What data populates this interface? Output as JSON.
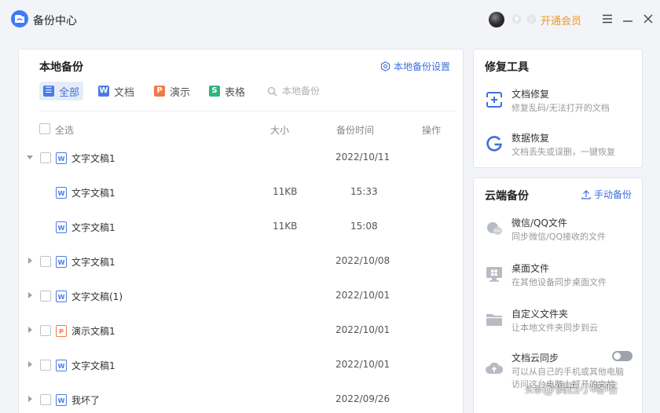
{
  "app": {
    "title": "备份中心"
  },
  "account": {
    "vip_link": "开通会员"
  },
  "local_backup": {
    "title": "本地备份",
    "settings_link": "本地备份设置",
    "filters": [
      {
        "label": "全部",
        "icon": "list-icon",
        "color": "#4a7be6"
      },
      {
        "label": "文档",
        "icon": "word-doc-icon",
        "color": "#4a7be6"
      },
      {
        "label": "演示",
        "icon": "presentation-icon",
        "color": "#f07a4a"
      },
      {
        "label": "表格",
        "icon": "spreadsheet-icon",
        "color": "#2eb57d"
      }
    ],
    "search_placeholder": "本地备份",
    "columns": {
      "select_all": "全选",
      "size": "大小",
      "time": "备份时间",
      "action": "操作"
    },
    "rows": [
      {
        "name": "文字文稿1",
        "type": "doc",
        "size": "",
        "time": "2022/10/11",
        "expanded": true
      },
      {
        "name": "文字文稿1",
        "type": "doc",
        "size": "11KB",
        "time": "15:33",
        "child": true
      },
      {
        "name": "文字文稿1",
        "type": "doc",
        "size": "11KB",
        "time": "15:08",
        "child": true
      },
      {
        "name": "文字文稿1",
        "type": "doc",
        "size": "",
        "time": "2022/10/08"
      },
      {
        "name": "文字文稿(1)",
        "type": "doc",
        "size": "",
        "time": "2022/10/01"
      },
      {
        "name": "演示文稿1",
        "type": "ppt",
        "size": "",
        "time": "2022/10/01"
      },
      {
        "name": "文字文稿1",
        "type": "doc",
        "size": "",
        "time": "2022/10/01"
      },
      {
        "name": "我坏了",
        "type": "doc",
        "size": "",
        "time": "2022/09/26"
      }
    ]
  },
  "repair_tools": {
    "title": "修复工具",
    "items": [
      {
        "title": "文档修复",
        "desc": "修复乱码/无法打开的文档"
      },
      {
        "title": "数据恢复",
        "desc": "文档丢失或误删，一键恢复"
      }
    ]
  },
  "cloud_backup": {
    "title": "云端备份",
    "manual_link": "手动备份",
    "items": [
      {
        "title": "微信/QQ文件",
        "desc": "同步微信/QQ接收的文件"
      },
      {
        "title": "桌面文件",
        "desc": "在其他设备同步桌面文件"
      },
      {
        "title": "自定义文件夹",
        "desc": "让本地文件夹同步到云"
      },
      {
        "title": "文档云同步",
        "desc": "可以从自己的手机或其他电脑",
        "desc2": "访问这台电脑上打开的文档"
      }
    ]
  },
  "watermark": {
    "prefix": "头条",
    "text": "@偶西小喀嗒"
  },
  "colors": {
    "accent": "#3d6fe0",
    "vip": "#e79a2e",
    "doc": "#4a7be6",
    "ppt": "#f07a4a",
    "sheet": "#2eb57d"
  }
}
